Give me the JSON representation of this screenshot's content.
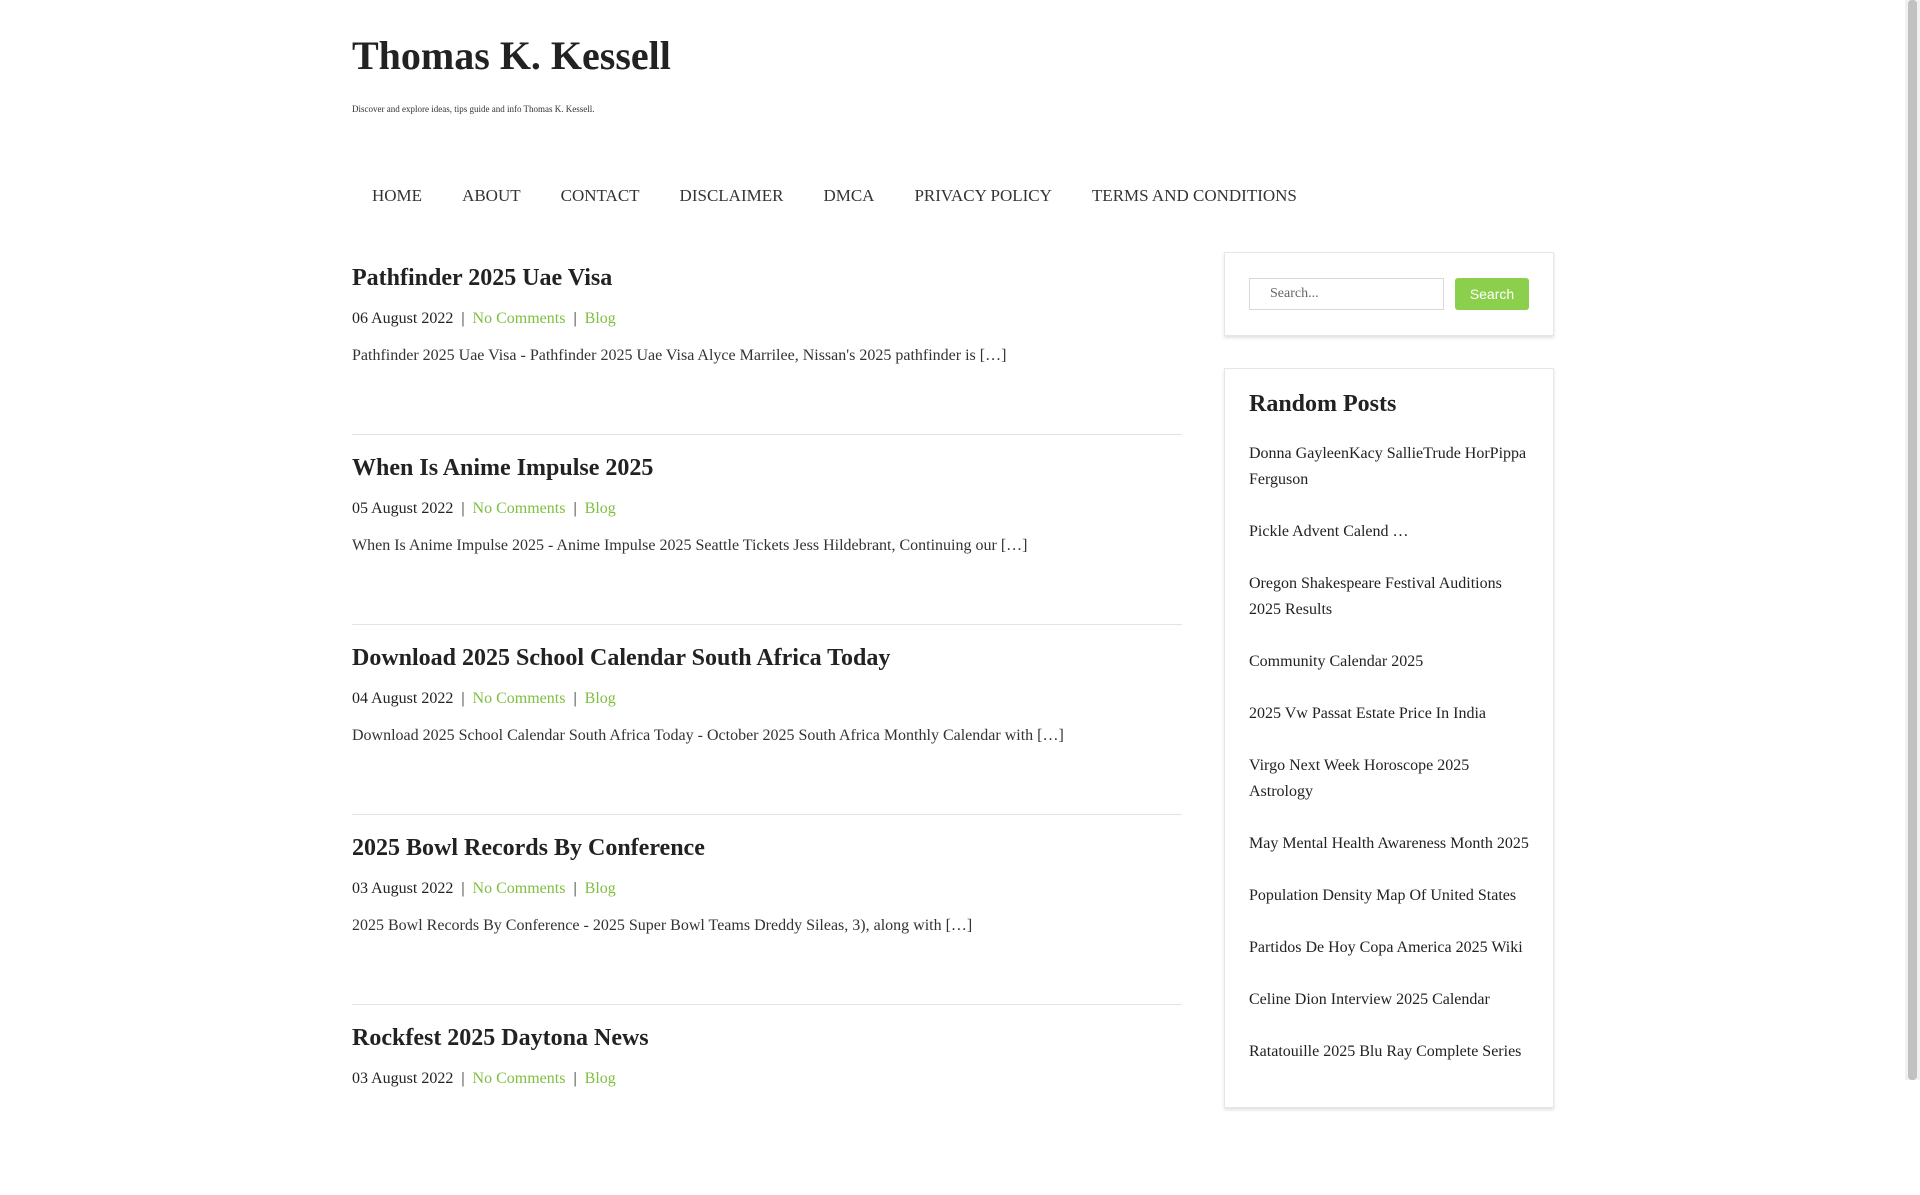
{
  "site": {
    "title": "Thomas K. Kessell",
    "description": "Discover and explore ideas, tips guide and info Thomas K. Kessell."
  },
  "nav": {
    "items": [
      "HOME",
      "ABOUT",
      "CONTACT",
      "DISCLAIMER",
      "DMCA",
      "PRIVACY POLICY",
      "TERMS AND CONDITIONS"
    ]
  },
  "posts": [
    {
      "title": "Pathfinder 2025 Uae Visa",
      "date": "06 August 2022",
      "comments": "No Comments",
      "category": "Blog",
      "excerpt": "Pathfinder 2025 Uae Visa - Pathfinder 2025 Uae Visa Alyce Marrilee, Nissan's 2025 pathfinder is […]"
    },
    {
      "title": "When Is Anime Impulse 2025",
      "date": "05 August 2022",
      "comments": "No Comments",
      "category": "Blog",
      "excerpt": "When Is Anime Impulse 2025 - Anime Impulse 2025 Seattle Tickets Jess Hildebrant, Continuing our […]"
    },
    {
      "title": "Download 2025 School Calendar South Africa Today",
      "date": "04 August 2022",
      "comments": "No Comments",
      "category": "Blog",
      "excerpt": "Download 2025 School Calendar South Africa Today - October 2025 South Africa Monthly Calendar with […]"
    },
    {
      "title": "2025 Bowl Records By Conference",
      "date": "03 August 2022",
      "comments": "No Comments",
      "category": "Blog",
      "excerpt": "2025 Bowl Records By Conference - 2025 Super Bowl Teams Dreddy Sileas, 3), along with […]"
    },
    {
      "title": "Rockfest 2025 Daytona News",
      "date": "03 August 2022",
      "comments": "No Comments",
      "category": "Blog",
      "excerpt": ""
    }
  ],
  "search": {
    "placeholder": "Search...",
    "button_label": "Search"
  },
  "random_posts": {
    "heading": "Random Posts",
    "items": [
      "Donna GayleenKacy SallieTrude HorPippa Ferguson",
      "Pickle Advent Calend …",
      "Oregon Shakespeare Festival Auditions 2025 Results",
      "Community Calendar 2025",
      "2025 Vw Passat Estate Price In India",
      "Virgo Next Week Horoscope 2025 Astrology",
      "May Mental Health Awareness Month 2025",
      "Population Density Map Of United States",
      "Partidos De Hoy Copa America 2025 Wiki",
      "Celine Dion Interview 2025 Calendar",
      "Ratatouille 2025 Blu Ray Complete Series"
    ]
  },
  "colors": {
    "link_green": "#7fbf3f",
    "button_green": "#8ccf4d"
  }
}
